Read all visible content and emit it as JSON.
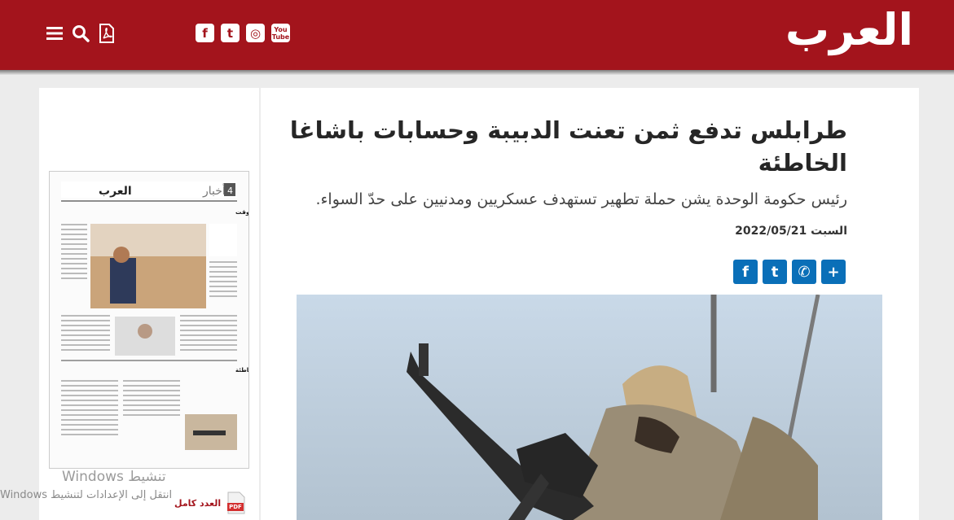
{
  "header": {
    "logo_text": "العرب",
    "brand_color": "#a3141c",
    "tools": [
      {
        "name": "menu-icon"
      },
      {
        "name": "search-icon"
      },
      {
        "name": "pdf-icon"
      }
    ],
    "socials": [
      {
        "name": "facebook-icon",
        "glyph": "f"
      },
      {
        "name": "twitter-icon",
        "glyph": "t"
      },
      {
        "name": "instagram-icon",
        "glyph": "◎"
      },
      {
        "name": "youtube-icon",
        "glyph_top": "You",
        "glyph_bottom": "Tube"
      }
    ]
  },
  "article": {
    "title": "طرابلس تدفع ثمن تعنت الدبيبة وحسابات باشاغا الخاطئة",
    "subtitle": "رئيس حكومة الوحدة يشن حملة تطهير تستهدف عسكريين ومدنيين على حدّ السواء.",
    "date": "السبت 2022/05/21",
    "share": [
      {
        "name": "share-facebook",
        "glyph": "f"
      },
      {
        "name": "share-twitter",
        "glyph": "t"
      },
      {
        "name": "share-whatsapp",
        "glyph": "✆"
      },
      {
        "name": "share-more",
        "glyph": "+"
      }
    ]
  },
  "sidebar": {
    "issue_link": "العدد كامل",
    "pdf_badge": "PDF",
    "thumb": {
      "masthead": "العرب",
      "section": "أخبار",
      "page_number": "4",
      "headline_top": "الهيئة المستقلة للانتخابات في تونس تحت ضغط الوقت",
      "headline_mid": "طرابلس تدفع ثمن تعنت الدبيبة وحسابات باشاغا الخاطئة"
    }
  },
  "watermark": {
    "line1": "تنشيط Windows",
    "line2": "انتقل إلى الإعدادات لتنشيط Windows"
  }
}
